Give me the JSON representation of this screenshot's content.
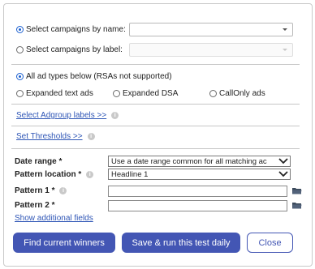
{
  "campaign_selection": {
    "by_name_label": "Select campaigns by name:",
    "by_label_label": "Select campaigns by label:"
  },
  "ad_types": {
    "all_label": "All ad types below (RSAs not supported)",
    "expanded_text": "Expanded text ads",
    "expanded_dsa": "Expanded DSA",
    "callonly": "CallOnly ads"
  },
  "links": {
    "adgroup_labels": "Select Adgroup labels >>",
    "thresholds": "Set Thresholds >>",
    "show_additional": "Show additional fields"
  },
  "form": {
    "date_range_label": "Date range *",
    "date_range_value": "Use a date range common for all matching ac",
    "pattern_location_label": "Pattern location *",
    "pattern_location_value": "Headline 1",
    "pattern1_label": "Pattern 1 *",
    "pattern2_label": "Pattern 2 *"
  },
  "buttons": {
    "find_winners": "Find current winners",
    "save_run": "Save & run this test daily",
    "close": "Close"
  },
  "info_glyph": "i",
  "colors": {
    "primary": "#4356b4",
    "link": "#2f56b6",
    "radio_checked": "#1a5fd0"
  },
  "icons": [
    "info-icon",
    "folder-icon",
    "chevron-down-icon"
  ]
}
